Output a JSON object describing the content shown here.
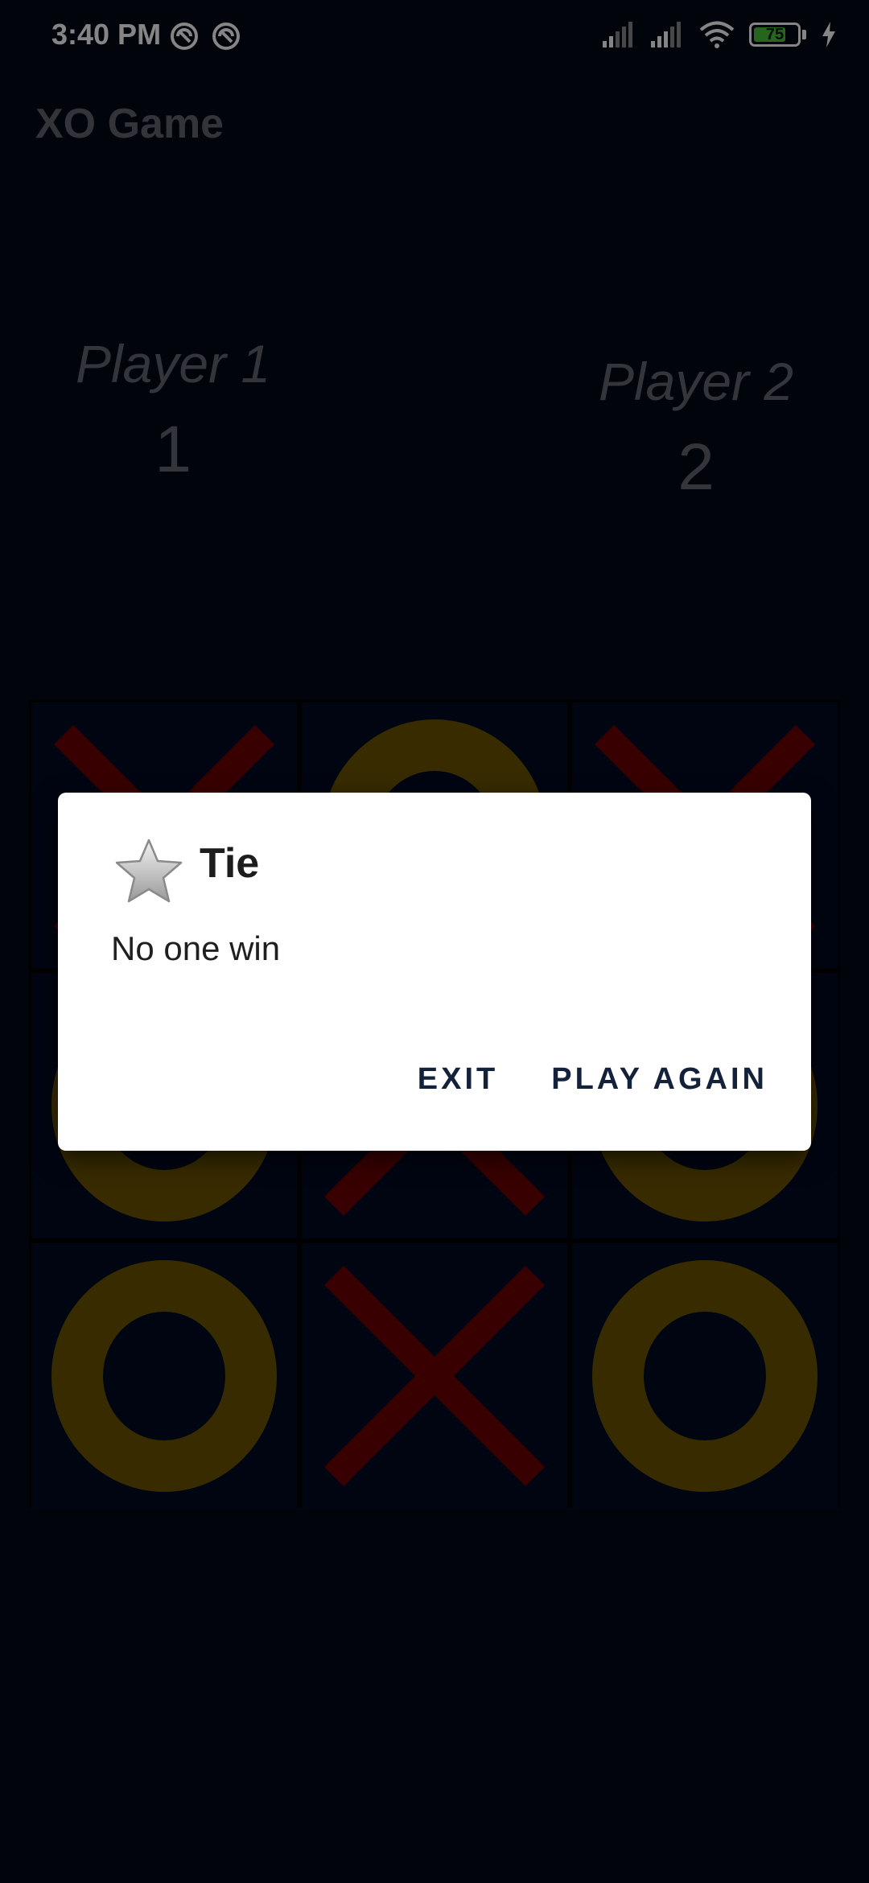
{
  "status_bar": {
    "time": "3:40 PM",
    "battery_level": "75",
    "battery_fraction": 0.75
  },
  "app": {
    "title": "XO Game"
  },
  "players": [
    {
      "name": "Player 1",
      "score": "1"
    },
    {
      "name": "Player 2",
      "score": "2"
    }
  ],
  "board": {
    "cells": [
      "X",
      "O",
      "X",
      "O",
      "X",
      "O",
      "O",
      "X",
      "O"
    ],
    "colors": {
      "x": "#6b0000",
      "o": "#6b5300",
      "cell": "#010a24"
    }
  },
  "dialog": {
    "icon": "star-icon",
    "title": "Tie",
    "message": "No one win",
    "buttons": {
      "exit": "EXIT",
      "play_again": "PLAY AGAIN"
    }
  }
}
